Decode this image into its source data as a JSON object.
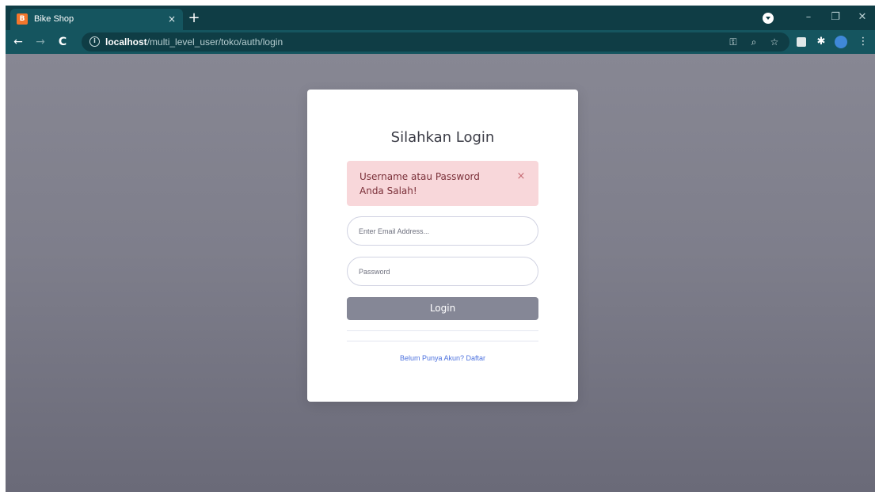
{
  "browser": {
    "tab": {
      "title": "Bike Shop",
      "favicon_letter": "B",
      "close_glyph": "×"
    },
    "new_tab_glyph": "+",
    "url_host": "localhost",
    "url_path": "/multi_level_user/toko/auth/login",
    "info_glyph": "i",
    "icons": [
      "key-icon",
      "zoom-icon",
      "star-icon",
      "extension-icon",
      "puzzle-icon",
      "profile-icon",
      "menu-icon"
    ],
    "window_controls": {
      "minimize": "–",
      "restore": "❐",
      "close": "✕"
    },
    "nav": {
      "back": "←",
      "forward": "→",
      "reload": "C"
    },
    "colors": {
      "frame": "#0f3d45",
      "toolbar": "#15555f"
    }
  },
  "login": {
    "title": "Silahkan Login",
    "alert_message": "Username atau Password Anda Salah!",
    "alert_close": "×",
    "email_placeholder": "Enter Email Address...",
    "password_placeholder": "Password",
    "login_button": "Login",
    "register_link": "Belum Punya Akun? Daftar"
  },
  "colors": {
    "alert_bg": "#f8d7da",
    "alert_text": "#7a2f38",
    "button": "#858796",
    "link": "#4e73df"
  }
}
